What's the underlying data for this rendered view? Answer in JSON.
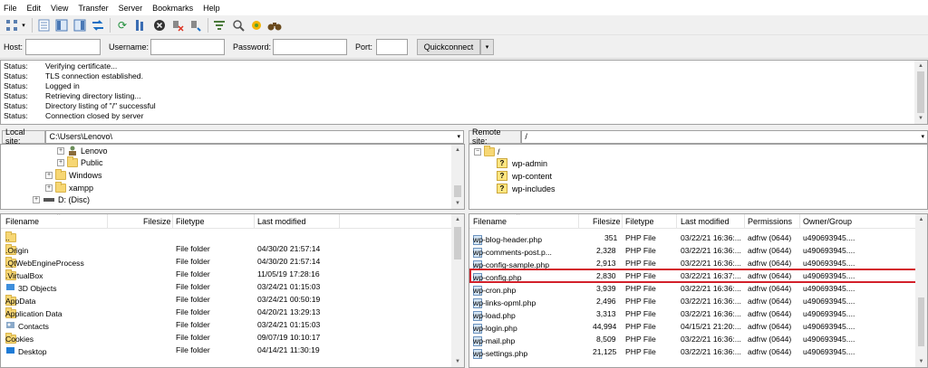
{
  "menu": [
    "File",
    "Edit",
    "View",
    "Transfer",
    "Server",
    "Bookmarks",
    "Help"
  ],
  "quickconnect": {
    "host_label": "Host:",
    "username_label": "Username:",
    "password_label": "Password:",
    "port_label": "Port:",
    "host_value": "",
    "username_value": "",
    "password_value": "",
    "port_value": "",
    "button": "Quickconnect"
  },
  "log": [
    {
      "k": "Status:",
      "v": "Verifying certificate..."
    },
    {
      "k": "Status:",
      "v": "TLS connection established."
    },
    {
      "k": "Status:",
      "v": "Logged in"
    },
    {
      "k": "Status:",
      "v": "Retrieving directory listing..."
    },
    {
      "k": "Status:",
      "v": "Directory listing of \"/\" successful"
    },
    {
      "k": "Status:",
      "v": "Connection closed by server"
    }
  ],
  "local": {
    "label": "Local site:",
    "path": "C:\\Users\\Lenovo\\",
    "tree": [
      "Lenovo",
      "Public",
      "Windows",
      "xampp",
      "D: (Disc)"
    ],
    "columns": [
      "Filename",
      "Filesize",
      "Filetype",
      "Last modified"
    ],
    "files": [
      {
        "name": "..",
        "size": "",
        "type": "",
        "modified": ""
      },
      {
        "name": ".Origin",
        "size": "",
        "type": "File folder",
        "modified": "04/30/20 21:57:14"
      },
      {
        "name": ".QtWebEngineProcess",
        "size": "",
        "type": "File folder",
        "modified": "04/30/20 21:57:14"
      },
      {
        "name": ".VirtualBox",
        "size": "",
        "type": "File folder",
        "modified": "11/05/19 17:28:16"
      },
      {
        "name": "3D Objects",
        "size": "",
        "type": "File folder",
        "modified": "03/24/21 01:15:03"
      },
      {
        "name": "AppData",
        "size": "",
        "type": "File folder",
        "modified": "03/24/21 00:50:19"
      },
      {
        "name": "Application Data",
        "size": "",
        "type": "File folder",
        "modified": "04/20/21 13:29:13"
      },
      {
        "name": "Contacts",
        "size": "",
        "type": "File folder",
        "modified": "03/24/21 01:15:03"
      },
      {
        "name": "Cookies",
        "size": "",
        "type": "File folder",
        "modified": "09/07/19 10:10:17"
      },
      {
        "name": "Desktop",
        "size": "",
        "type": "File folder",
        "modified": "04/14/21 11:30:19"
      }
    ]
  },
  "remote": {
    "label": "Remote site:",
    "path": "/",
    "tree": [
      "/",
      "wp-admin",
      "wp-content",
      "wp-includes"
    ],
    "columns": [
      "Filename",
      "Filesize",
      "Filetype",
      "Last modified",
      "Permissions",
      "Owner/Group"
    ],
    "files": [
      {
        "name": "wp-blog-header.php",
        "size": "351",
        "type": "PHP File",
        "modified": "03/22/21 16:36:...",
        "perm": "adfrw (0644)",
        "owner": "u490693945...."
      },
      {
        "name": "wp-comments-post.p...",
        "size": "2,328",
        "type": "PHP File",
        "modified": "03/22/21 16:36:...",
        "perm": "adfrw (0644)",
        "owner": "u490693945...."
      },
      {
        "name": "wp-config-sample.php",
        "size": "2,913",
        "type": "PHP File",
        "modified": "03/22/21 16:36:...",
        "perm": "adfrw (0644)",
        "owner": "u490693945...."
      },
      {
        "name": "wp-config.php",
        "size": "2,830",
        "type": "PHP File",
        "modified": "03/22/21 16:37:...",
        "perm": "adfrw (0644)",
        "owner": "u490693945...."
      },
      {
        "name": "wp-cron.php",
        "size": "3,939",
        "type": "PHP File",
        "modified": "03/22/21 16:36:...",
        "perm": "adfrw (0644)",
        "owner": "u490693945...."
      },
      {
        "name": "wp-links-opml.php",
        "size": "2,496",
        "type": "PHP File",
        "modified": "03/22/21 16:36:...",
        "perm": "adfrw (0644)",
        "owner": "u490693945...."
      },
      {
        "name": "wp-load.php",
        "size": "3,313",
        "type": "PHP File",
        "modified": "03/22/21 16:36:...",
        "perm": "adfrw (0644)",
        "owner": "u490693945...."
      },
      {
        "name": "wp-login.php",
        "size": "44,994",
        "type": "PHP File",
        "modified": "04/15/21 21:20:...",
        "perm": "adfrw (0644)",
        "owner": "u490693945...."
      },
      {
        "name": "wp-mail.php",
        "size": "8,509",
        "type": "PHP File",
        "modified": "03/22/21 16:36:...",
        "perm": "adfrw (0644)",
        "owner": "u490693945...."
      },
      {
        "name": "wp-settings.php",
        "size": "21,125",
        "type": "PHP File",
        "modified": "03/22/21 16:36:...",
        "perm": "adfrw (0644)",
        "owner": "u490693945...."
      }
    ]
  }
}
